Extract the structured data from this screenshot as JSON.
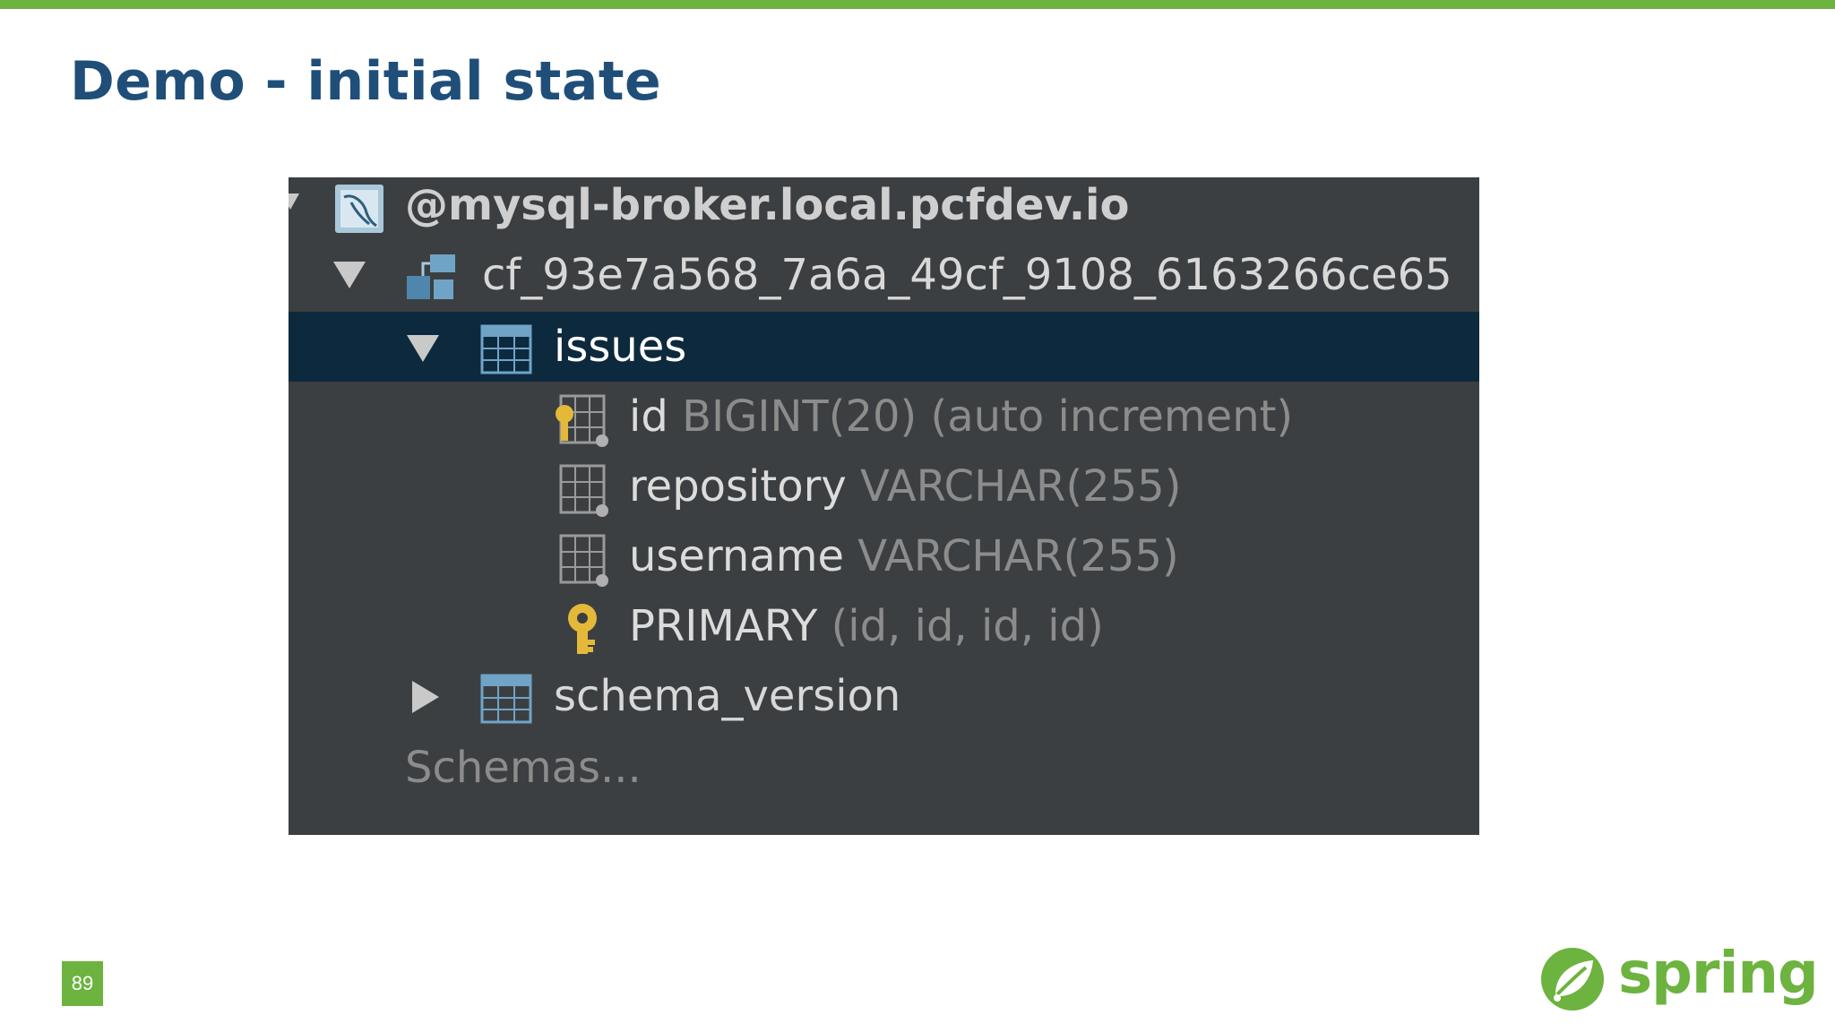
{
  "slide": {
    "title": "Demo - initial state",
    "page_number": "89",
    "logo_text": "spring",
    "accent_color": "#6db33f",
    "title_color": "#1f4e79"
  },
  "db_tree": {
    "background": "#3c3f41",
    "selected_background": "#0d293e",
    "nodes": [
      {
        "label": "@mysql-broker.local.pcfdev.io",
        "icon": "mysql-datasource-icon",
        "expanded": true
      },
      {
        "label": "cf_93e7a568_7a6a_49cf_9108_6163266ce65",
        "icon": "schema-icon",
        "expanded": true
      },
      {
        "label": "issues",
        "icon": "table-icon",
        "expanded": true,
        "selected": true
      },
      {
        "name": "id",
        "type": "BIGINT(20) (auto increment)",
        "icon": "primary-key-column-icon"
      },
      {
        "name": "repository",
        "type": "VARCHAR(255)",
        "icon": "column-icon"
      },
      {
        "name": "username",
        "type": "VARCHAR(255)",
        "icon": "column-icon"
      },
      {
        "name": "PRIMARY",
        "type": "(id, id, id, id)",
        "icon": "key-icon"
      },
      {
        "label": "schema_version",
        "icon": "table-icon",
        "expanded": false
      }
    ],
    "schemas_link": "Schemas..."
  }
}
